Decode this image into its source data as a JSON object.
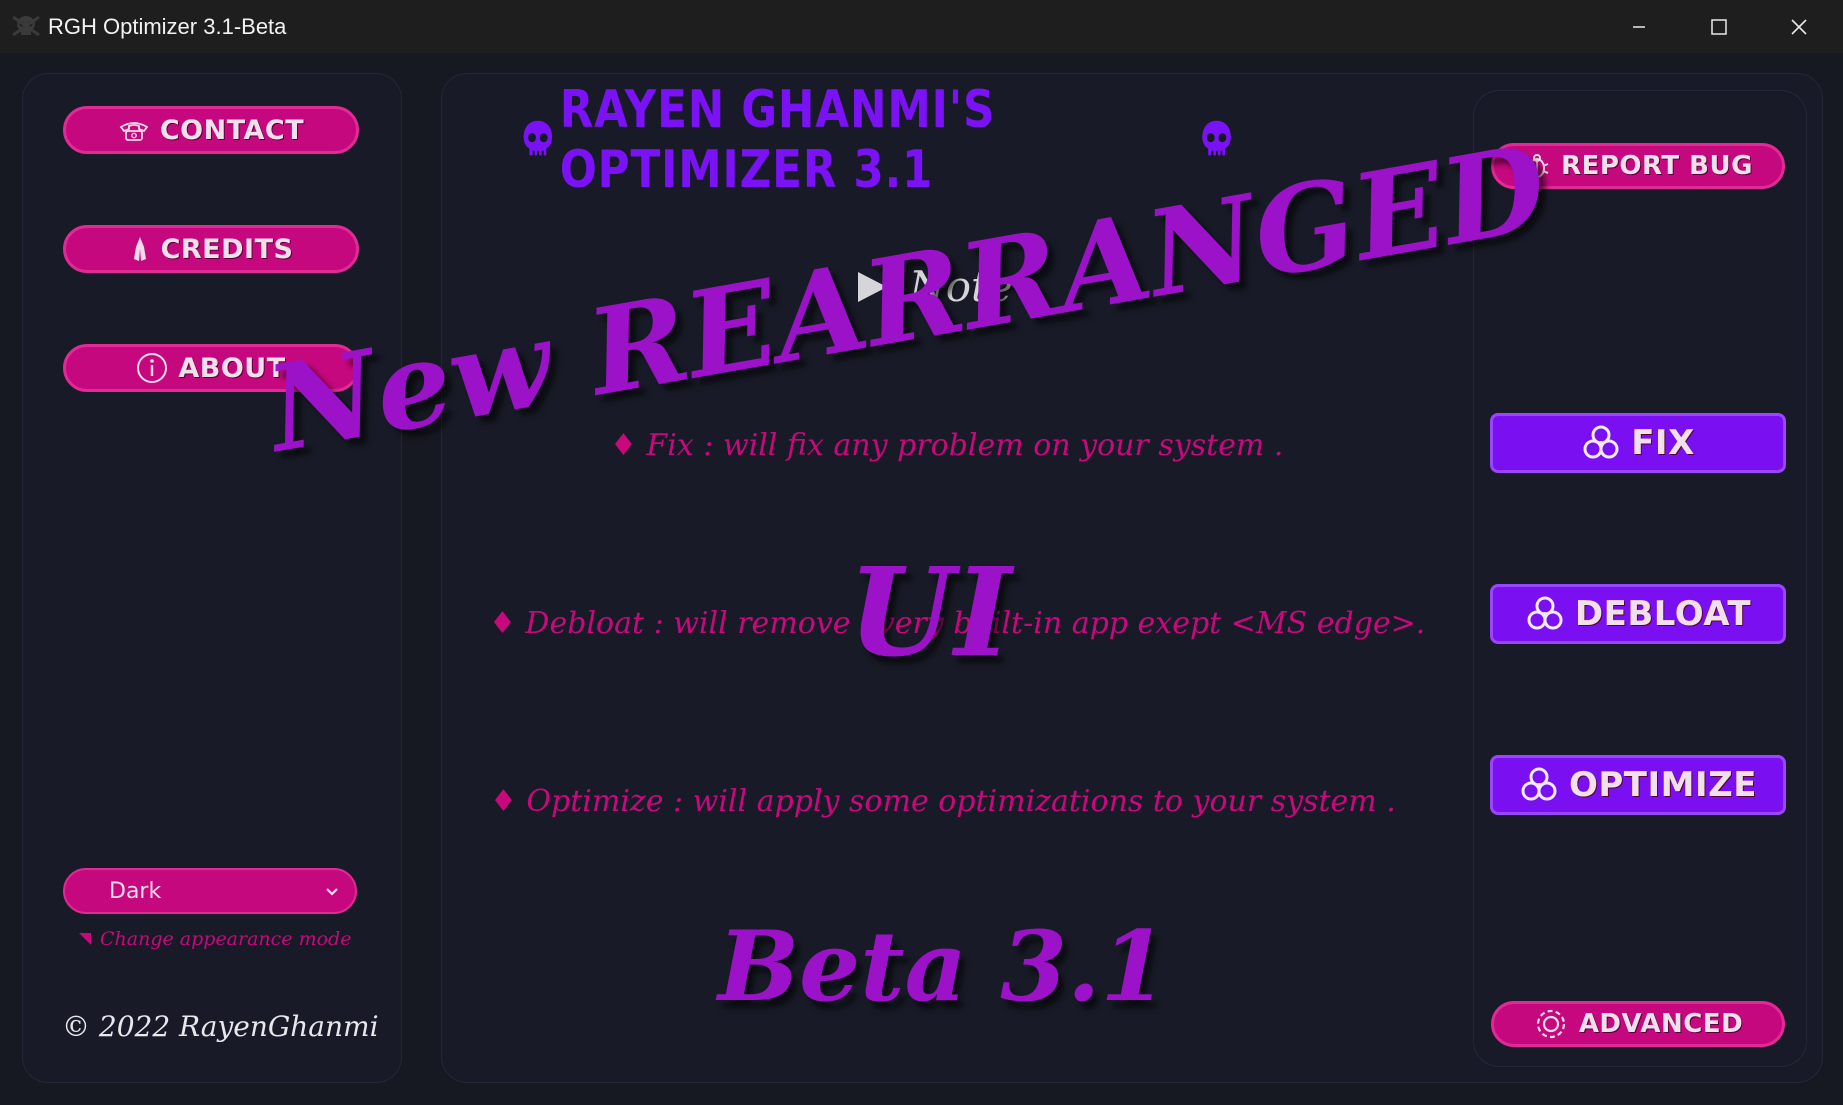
{
  "window": {
    "title": "RGH Optimizer 3.1-Beta",
    "controls": [
      "minimize",
      "maximize",
      "close"
    ]
  },
  "sidebar": {
    "buttons": [
      {
        "label": "CONTACT",
        "icon": "telephone-icon"
      },
      {
        "label": "CREDITS",
        "icon": "praying-hands-icon"
      },
      {
        "label": "ABOUT",
        "icon": "info-icon"
      }
    ],
    "appearance_select": {
      "value": "Dark"
    },
    "appearance_note": "Change appearance mode",
    "copyright": "© 2022 RayenGhanmi"
  },
  "main": {
    "heading": "RAYEN GHANMI'S OPTIMIZER 3.1",
    "heading_icon": "skull-icon",
    "note_label": "Note :",
    "descriptions": [
      "♦ Fix : will fix any problem on your system .",
      "♦ Debloat : will remove every built-in app exept <MS edge>.",
      "♦ Optimize : will apply some optimizations to your system ."
    ]
  },
  "overlay": {
    "line1": "New REARRANGED",
    "line2": "UI",
    "beta": "Beta 3.1"
  },
  "right_panel": {
    "report_bug": "REPORT BUG",
    "fix": "FIX",
    "debloat": "DEBLOAT",
    "optimize": "OPTIMIZE",
    "advanced": "ADVANCED"
  },
  "colors": {
    "background": "#161922",
    "panel": "#181b27",
    "pink": "#c6087e",
    "violet": "#7a10f2",
    "overlay_purple": "#9b12c8"
  }
}
